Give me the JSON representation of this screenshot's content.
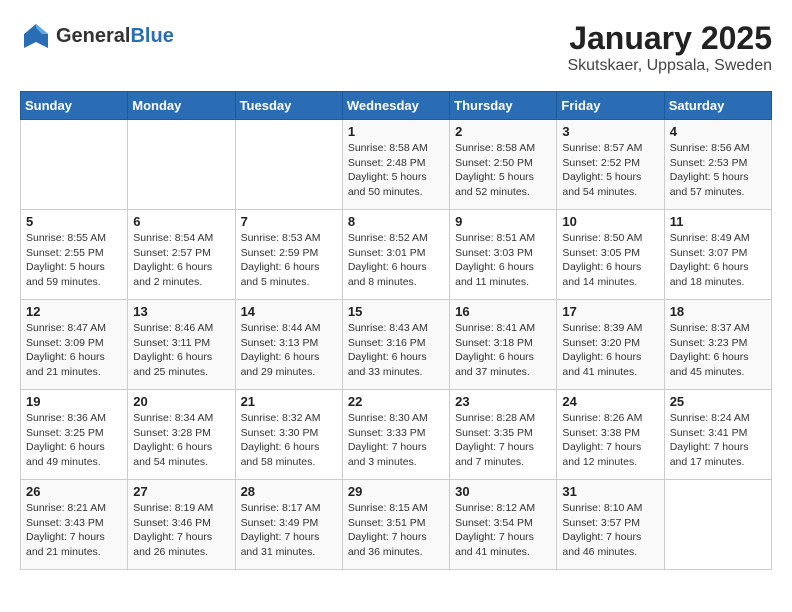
{
  "logo": {
    "general": "General",
    "blue": "Blue"
  },
  "title": "January 2025",
  "subtitle": "Skutskaer, Uppsala, Sweden",
  "days_of_week": [
    "Sunday",
    "Monday",
    "Tuesday",
    "Wednesday",
    "Thursday",
    "Friday",
    "Saturday"
  ],
  "weeks": [
    [
      {
        "day": "",
        "info": ""
      },
      {
        "day": "",
        "info": ""
      },
      {
        "day": "",
        "info": ""
      },
      {
        "day": "1",
        "info": "Sunrise: 8:58 AM\nSunset: 2:48 PM\nDaylight: 5 hours\nand 50 minutes."
      },
      {
        "day": "2",
        "info": "Sunrise: 8:58 AM\nSunset: 2:50 PM\nDaylight: 5 hours\nand 52 minutes."
      },
      {
        "day": "3",
        "info": "Sunrise: 8:57 AM\nSunset: 2:52 PM\nDaylight: 5 hours\nand 54 minutes."
      },
      {
        "day": "4",
        "info": "Sunrise: 8:56 AM\nSunset: 2:53 PM\nDaylight: 5 hours\nand 57 minutes."
      }
    ],
    [
      {
        "day": "5",
        "info": "Sunrise: 8:55 AM\nSunset: 2:55 PM\nDaylight: 5 hours\nand 59 minutes."
      },
      {
        "day": "6",
        "info": "Sunrise: 8:54 AM\nSunset: 2:57 PM\nDaylight: 6 hours\nand 2 minutes."
      },
      {
        "day": "7",
        "info": "Sunrise: 8:53 AM\nSunset: 2:59 PM\nDaylight: 6 hours\nand 5 minutes."
      },
      {
        "day": "8",
        "info": "Sunrise: 8:52 AM\nSunset: 3:01 PM\nDaylight: 6 hours\nand 8 minutes."
      },
      {
        "day": "9",
        "info": "Sunrise: 8:51 AM\nSunset: 3:03 PM\nDaylight: 6 hours\nand 11 minutes."
      },
      {
        "day": "10",
        "info": "Sunrise: 8:50 AM\nSunset: 3:05 PM\nDaylight: 6 hours\nand 14 minutes."
      },
      {
        "day": "11",
        "info": "Sunrise: 8:49 AM\nSunset: 3:07 PM\nDaylight: 6 hours\nand 18 minutes."
      }
    ],
    [
      {
        "day": "12",
        "info": "Sunrise: 8:47 AM\nSunset: 3:09 PM\nDaylight: 6 hours\nand 21 minutes."
      },
      {
        "day": "13",
        "info": "Sunrise: 8:46 AM\nSunset: 3:11 PM\nDaylight: 6 hours\nand 25 minutes."
      },
      {
        "day": "14",
        "info": "Sunrise: 8:44 AM\nSunset: 3:13 PM\nDaylight: 6 hours\nand 29 minutes."
      },
      {
        "day": "15",
        "info": "Sunrise: 8:43 AM\nSunset: 3:16 PM\nDaylight: 6 hours\nand 33 minutes."
      },
      {
        "day": "16",
        "info": "Sunrise: 8:41 AM\nSunset: 3:18 PM\nDaylight: 6 hours\nand 37 minutes."
      },
      {
        "day": "17",
        "info": "Sunrise: 8:39 AM\nSunset: 3:20 PM\nDaylight: 6 hours\nand 41 minutes."
      },
      {
        "day": "18",
        "info": "Sunrise: 8:37 AM\nSunset: 3:23 PM\nDaylight: 6 hours\nand 45 minutes."
      }
    ],
    [
      {
        "day": "19",
        "info": "Sunrise: 8:36 AM\nSunset: 3:25 PM\nDaylight: 6 hours\nand 49 minutes."
      },
      {
        "day": "20",
        "info": "Sunrise: 8:34 AM\nSunset: 3:28 PM\nDaylight: 6 hours\nand 54 minutes."
      },
      {
        "day": "21",
        "info": "Sunrise: 8:32 AM\nSunset: 3:30 PM\nDaylight: 6 hours\nand 58 minutes."
      },
      {
        "day": "22",
        "info": "Sunrise: 8:30 AM\nSunset: 3:33 PM\nDaylight: 7 hours\nand 3 minutes."
      },
      {
        "day": "23",
        "info": "Sunrise: 8:28 AM\nSunset: 3:35 PM\nDaylight: 7 hours\nand 7 minutes."
      },
      {
        "day": "24",
        "info": "Sunrise: 8:26 AM\nSunset: 3:38 PM\nDaylight: 7 hours\nand 12 minutes."
      },
      {
        "day": "25",
        "info": "Sunrise: 8:24 AM\nSunset: 3:41 PM\nDaylight: 7 hours\nand 17 minutes."
      }
    ],
    [
      {
        "day": "26",
        "info": "Sunrise: 8:21 AM\nSunset: 3:43 PM\nDaylight: 7 hours\nand 21 minutes."
      },
      {
        "day": "27",
        "info": "Sunrise: 8:19 AM\nSunset: 3:46 PM\nDaylight: 7 hours\nand 26 minutes."
      },
      {
        "day": "28",
        "info": "Sunrise: 8:17 AM\nSunset: 3:49 PM\nDaylight: 7 hours\nand 31 minutes."
      },
      {
        "day": "29",
        "info": "Sunrise: 8:15 AM\nSunset: 3:51 PM\nDaylight: 7 hours\nand 36 minutes."
      },
      {
        "day": "30",
        "info": "Sunrise: 8:12 AM\nSunset: 3:54 PM\nDaylight: 7 hours\nand 41 minutes."
      },
      {
        "day": "31",
        "info": "Sunrise: 8:10 AM\nSunset: 3:57 PM\nDaylight: 7 hours\nand 46 minutes."
      },
      {
        "day": "",
        "info": ""
      }
    ]
  ]
}
